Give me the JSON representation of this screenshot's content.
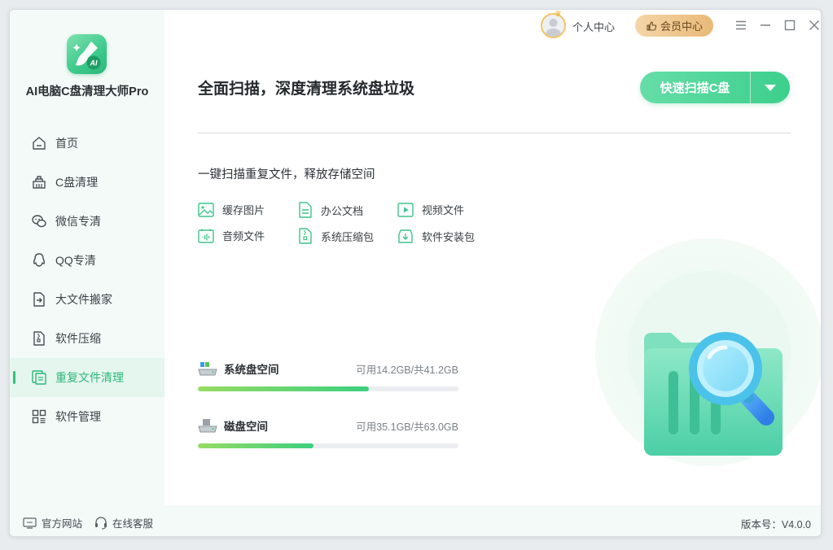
{
  "app": {
    "name": "AI电脑C盘清理大师Pro",
    "logo_text": "AI"
  },
  "topbar": {
    "user_center": "个人中心",
    "vip_center": "会员中心"
  },
  "sidebar": {
    "items": [
      {
        "label": "首页",
        "icon": "home-icon"
      },
      {
        "label": "C盘清理",
        "icon": "broom-icon"
      },
      {
        "label": "微信专清",
        "icon": "wechat-icon"
      },
      {
        "label": "QQ专清",
        "icon": "qq-icon"
      },
      {
        "label": "大文件搬家",
        "icon": "move-file-icon"
      },
      {
        "label": "软件压缩",
        "icon": "zip-icon"
      },
      {
        "label": "重复文件清理",
        "icon": "duplicate-file-icon",
        "active": true
      },
      {
        "label": "软件管理",
        "icon": "apps-icon"
      }
    ]
  },
  "main": {
    "title": "全面扫描，深度清理系统盘垃圾",
    "scan_button": "快速扫描C盘",
    "subtitle": "一键扫描重复文件，释放存储空间",
    "file_types": [
      {
        "label": "缓存图片",
        "icon": "image-icon"
      },
      {
        "label": "办公文档",
        "icon": "document-icon"
      },
      {
        "label": "视频文件",
        "icon": "video-icon"
      },
      {
        "label": "音频文件",
        "icon": "audio-icon"
      },
      {
        "label": "系统压缩包",
        "icon": "archive-icon"
      },
      {
        "label": "软件安装包",
        "icon": "installer-icon"
      }
    ],
    "disks": [
      {
        "name": "系统盘空间",
        "info": "可用14.2GB/共41.2GB",
        "used_percent": 65.5,
        "icon": "system-disk-icon"
      },
      {
        "name": "磁盘空间",
        "info": "可用35.1GB/共63.0GB",
        "used_percent": 44.3,
        "icon": "disk-icon"
      }
    ]
  },
  "footer": {
    "website": "官方网站",
    "support": "在线客服",
    "version": "版本号：V4.0.0"
  },
  "colors": {
    "accent": "#31c27f",
    "vip": "#e9b978"
  }
}
